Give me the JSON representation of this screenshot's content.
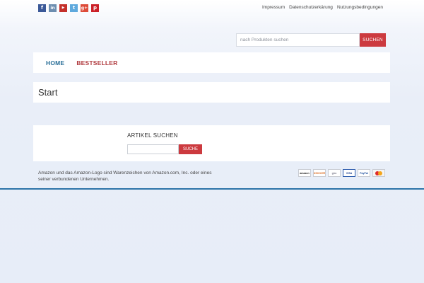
{
  "social": [
    {
      "name": "facebook-icon",
      "glyph": "f",
      "color": "#3b5998"
    },
    {
      "name": "linkedin-icon",
      "glyph": "in",
      "color": "#6d8eb0"
    },
    {
      "name": "youtube-icon",
      "glyph": "▶",
      "color": "#c4302b"
    },
    {
      "name": "twitter-icon",
      "glyph": "t",
      "color": "#5ea9dd"
    },
    {
      "name": "googleplus-icon",
      "glyph": "g+",
      "color": "#dd4b39"
    },
    {
      "name": "pinterest-icon",
      "glyph": "p",
      "color": "#cb2027"
    }
  ],
  "toplinks": {
    "impressum": "Impressum",
    "datenschutz": "Datenschutzerkärung",
    "nutzung": "Nutzungsbedingungen"
  },
  "search": {
    "placeholder": "nach Produkten suchen",
    "button": "SUCHEN"
  },
  "nav": {
    "home": "HOME",
    "bestseller": "BESTSELLER"
  },
  "page": {
    "title": "Start"
  },
  "widget": {
    "title": "ARTIKEL SUCHEN",
    "button": "SUCHE",
    "input_value": ""
  },
  "footer": {
    "disclaimer": "Amazon und das Amazon-Logo sind Warenzeichen von Amazon.com, Inc. oder eines seiner verbundenen Unternehmen."
  },
  "payments": [
    {
      "name": "amazon-payment-icon",
      "label": "amazon"
    },
    {
      "name": "discover-payment-icon",
      "label": "DISCOVER"
    },
    {
      "name": "giropay-payment-icon",
      "label": "giro"
    },
    {
      "name": "visa-payment-icon",
      "label": "VISA"
    },
    {
      "name": "paypal-payment-icon",
      "label": "PayPal"
    },
    {
      "name": "mastercard-payment-icon",
      "label": ""
    }
  ],
  "colors": {
    "accent_red": "#cc3a3f",
    "nav_blue": "#2a6f98",
    "nav_red": "#b03a3e",
    "footer_line": "#2d74a8"
  }
}
